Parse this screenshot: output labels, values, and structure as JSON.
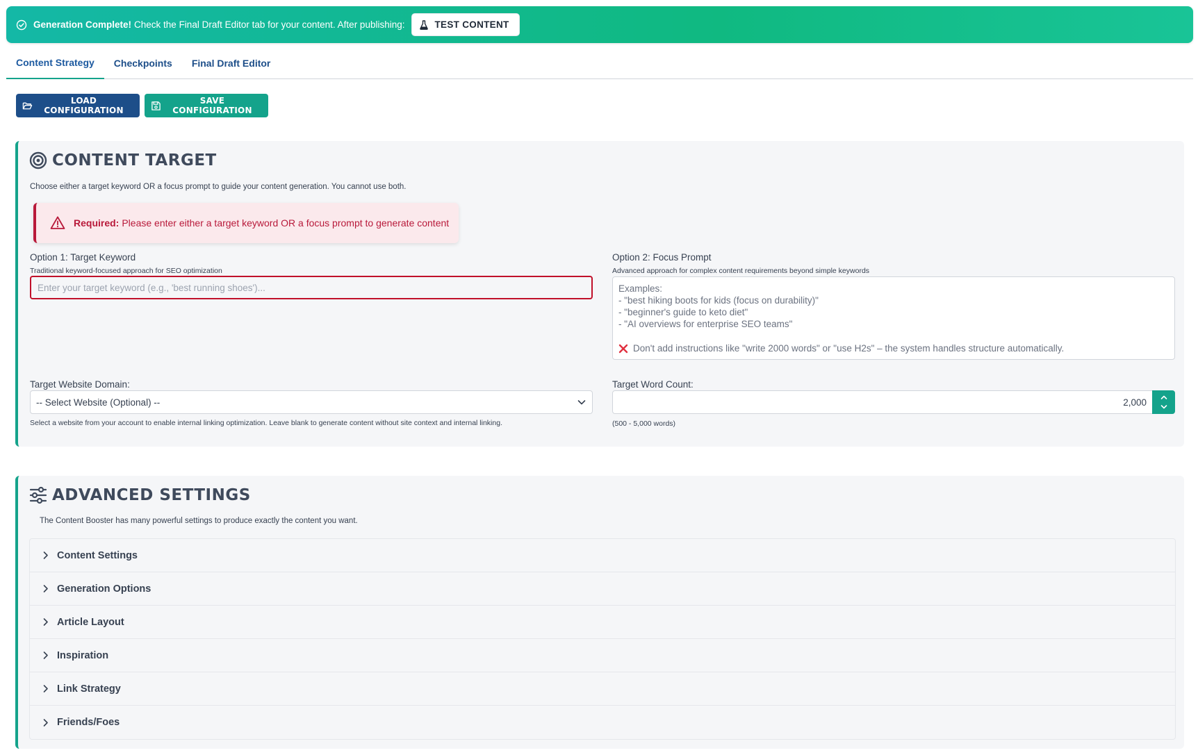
{
  "banner": {
    "strong": "Generation Complete!",
    "message": "Check the Final Draft Editor tab for your content. After publishing:",
    "test_button": "TEST CONTENT"
  },
  "tabs": [
    {
      "label": "Content Strategy",
      "active": true
    },
    {
      "label": "Checkpoints",
      "active": false
    },
    {
      "label": "Final Draft Editor",
      "active": false
    }
  ],
  "config": {
    "load_label": "Load Configuration",
    "save_label": "Save Configuration"
  },
  "content_target": {
    "title": "Content Target",
    "description": "Choose either a target keyword OR a focus prompt to guide your content generation. You cannot use both.",
    "alert": {
      "strong": "Required:",
      "message": "Please enter either a target keyword OR a focus prompt to generate content"
    },
    "option1": {
      "label": "Option 1: Target Keyword",
      "help": "Traditional keyword-focused approach for SEO optimization",
      "placeholder": "Enter your target keyword (e.g., 'best running shoes')...",
      "value": ""
    },
    "option2": {
      "label": "Option 2: Focus Prompt",
      "help": "Advanced approach for complex content requirements beyond simple keywords",
      "examples_heading": "Examples:",
      "examples": [
        "- \"best hiking boots for kids (focus on durability)\"",
        "- \"beginner's guide to keto diet\"",
        "- \"AI overviews for enterprise SEO teams\""
      ],
      "warning": "Don't add instructions like \"write 2000 words\" or \"use H2s\" – the system handles structure automatically."
    },
    "domain": {
      "label": "Target Website Domain:",
      "selected": "-- Select Website (Optional) --",
      "help": "Select a website from your account to enable internal linking optimization. Leave blank to generate content without site context and internal linking."
    },
    "word_count": {
      "label": "Target Word Count:",
      "value": "2,000",
      "range": "(500 - 5,000 words)"
    }
  },
  "advanced": {
    "title": "Advanced Settings",
    "description": "The Content Booster has many powerful settings to produce exactly the content you want.",
    "sections": [
      "Content Settings",
      "Generation Options",
      "Article Layout",
      "Inspiration",
      "Link Strategy",
      "Friends/Foes"
    ]
  },
  "colors": {
    "accent": "#14a38b",
    "brand": "#1d4e89",
    "error": "#b8193a"
  }
}
